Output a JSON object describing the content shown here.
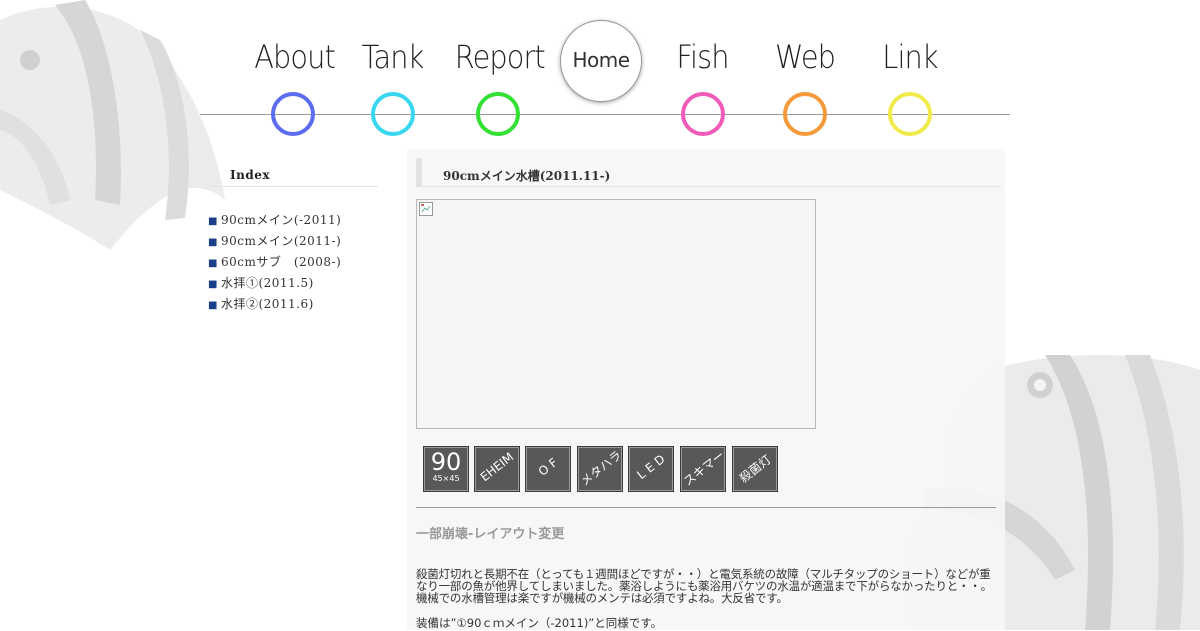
{
  "nav": {
    "items": [
      {
        "label": "About",
        "color": "#5b6cf0"
      },
      {
        "label": "Tank",
        "color": "#39d8f0"
      },
      {
        "label": "Report",
        "color": "#33e033"
      },
      {
        "label": "Fish",
        "color": "#f05bb8"
      },
      {
        "label": "Web",
        "color": "#f59a3a"
      },
      {
        "label": "Link",
        "color": "#f0ea4a"
      }
    ],
    "home_label": "Home"
  },
  "sidebar": {
    "title": "Index",
    "bullet": "■",
    "items": [
      {
        "label": "90cmメイン(-2011)"
      },
      {
        "label": "90cmメイン(2011-)"
      },
      {
        "label": "60cmサブ　(2008-)"
      },
      {
        "label": "水拝①(2011.5)"
      },
      {
        "label": "水拝②(2011.6)"
      }
    ]
  },
  "main": {
    "title": "90cmメイン水槽(2011.11-)",
    "badges": [
      {
        "big": "90",
        "small": "45×45"
      },
      {
        "label": "EHEIM"
      },
      {
        "label": "O F"
      },
      {
        "label": "メタハラ"
      },
      {
        "label": "L E D"
      },
      {
        "label": "スキマー"
      },
      {
        "label": "殺菌灯"
      }
    ],
    "subheading": "一部崩壊-レイアウト変更",
    "paragraph": "殺菌灯切れと長期不在（とっても１週間ほどですが・・）と電気系統の故障（マルチタップのショート）などが重なり一部の魚が他界してしまいました。薬浴しようにも薬浴用バケツの水温が適温まで下がらなかったりと・・。機械での水槽管理は楽ですが機械のメンテは必須ですよね。大反省です。",
    "paragraph2": "装備は”①90ｃｍメイン（-2011)”と同様です。"
  }
}
